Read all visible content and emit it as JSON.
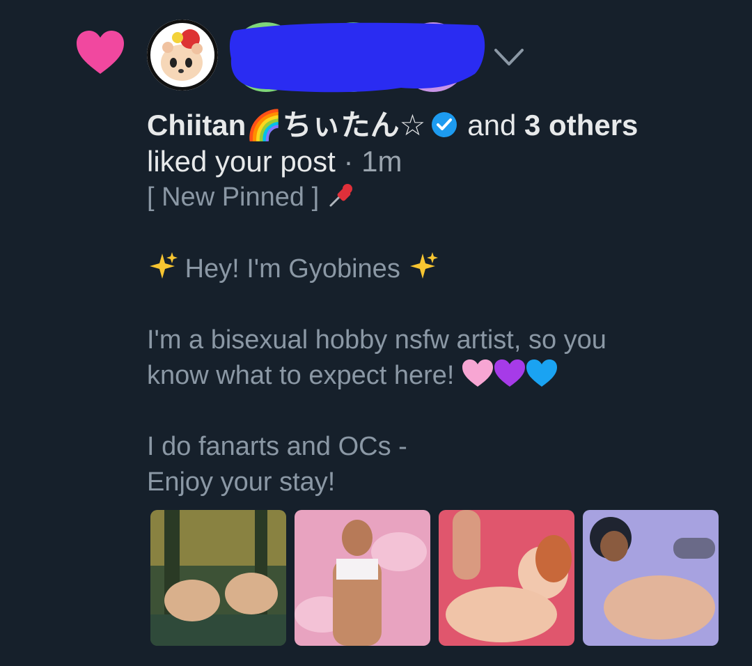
{
  "icons": {
    "like": "heart-icon",
    "verified": "verified-badge-icon",
    "more": "chevron-down-icon",
    "pin": "pushpin-icon",
    "sparkles": "sparkles-icon",
    "hearts": [
      "pink-heart-icon",
      "purple-heart-icon",
      "blue-heart-icon"
    ]
  },
  "colors": {
    "background": "#16202b",
    "like_heart": "#f1489f",
    "verified": "#1d9bf0",
    "primary_text": "#e7e9ea",
    "secondary_text": "#8b98a5",
    "redaction": "#2a2cf2"
  },
  "notification": {
    "liker_name": "Chiitan🌈ちぃたん☆",
    "and_text": "and",
    "others_count_text": "3 others",
    "action_text": "liked your post",
    "separator": "·",
    "time": "1m"
  },
  "post": {
    "pinned_label": "[ New Pinned ]",
    "greeting": "Hey! I'm Gyobines",
    "line1": "I'm a bisexual hobby nsfw artist, so you",
    "line2": "know what to expect here!",
    "line3": "I do fanarts and OCs -",
    "line4": "Enjoy your stay!"
  },
  "media": {
    "count": 4
  }
}
